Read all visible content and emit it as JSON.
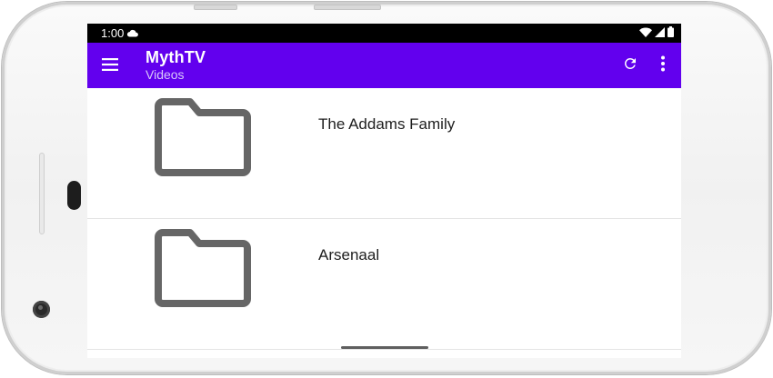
{
  "status_bar": {
    "time": "1:00",
    "icons": [
      "cloud-icon",
      "wifi-icon",
      "signal-icon",
      "battery-icon"
    ]
  },
  "app_bar": {
    "title": "MythTV",
    "subtitle": "Videos",
    "background": "#6200ee",
    "icons": [
      "menu-icon",
      "refresh-icon",
      "more-vert-icon"
    ]
  },
  "list": {
    "items": [
      {
        "label": "The Addams Family",
        "icon": "folder-icon"
      },
      {
        "label": "Arsenaal",
        "icon": "folder-icon"
      }
    ]
  },
  "colors": {
    "accent": "#6200ee",
    "folder_icon": "#666666"
  }
}
